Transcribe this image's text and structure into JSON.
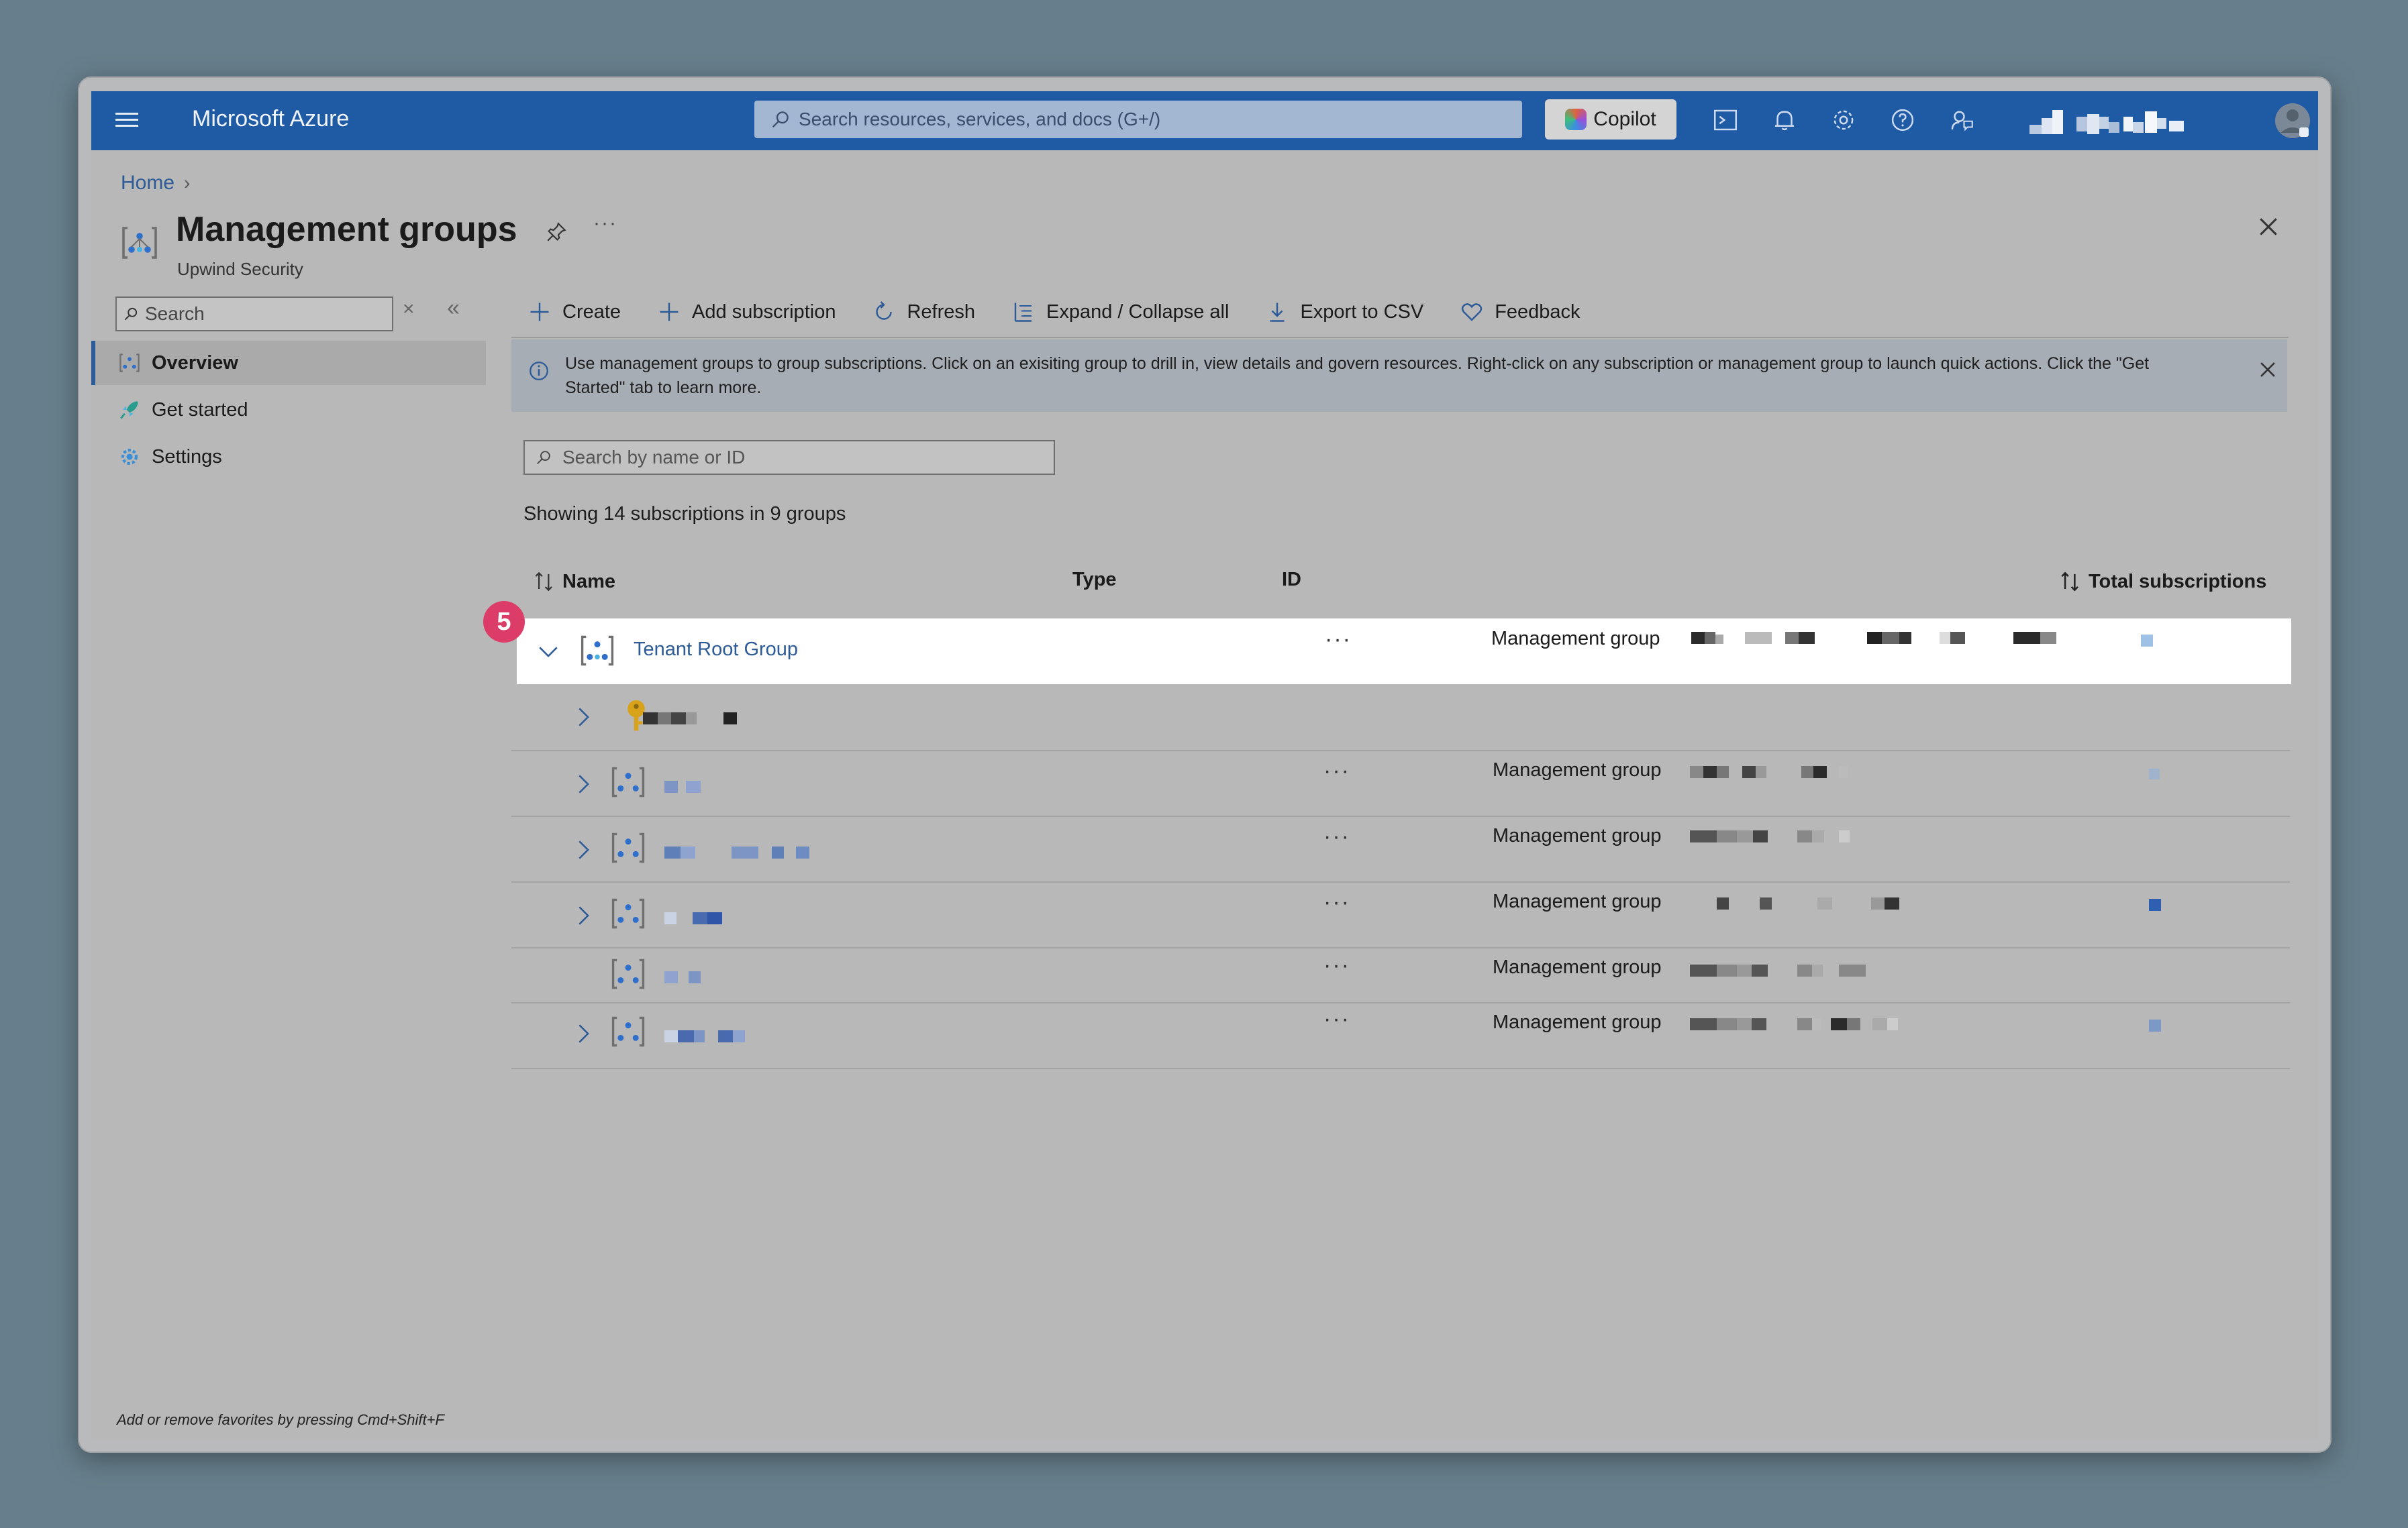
{
  "topbar": {
    "brand": "Microsoft Azure",
    "search_placeholder": "Search resources, services, and docs (G+/)",
    "copilot_label": "Copilot",
    "icons": [
      "cloud-shell-icon",
      "bell-icon",
      "gear-icon",
      "help-icon",
      "feedback-icon",
      "avatar"
    ]
  },
  "breadcrumb": {
    "home": "Home"
  },
  "header": {
    "title": "Management groups",
    "subtitle": "Upwind Security",
    "more": "···"
  },
  "nav": {
    "search_placeholder": "Search",
    "clear": "×",
    "collapse": "«",
    "items": [
      {
        "label": "Overview",
        "icon": "management-group-icon",
        "active": true
      },
      {
        "label": "Get started",
        "icon": "rocket-icon",
        "active": false
      },
      {
        "label": "Settings",
        "icon": "gear-icon",
        "active": false
      }
    ],
    "footer": "Add or remove favorites by pressing Cmd+Shift+F"
  },
  "toolbar": {
    "create": "Create",
    "add_subscription": "Add subscription",
    "refresh": "Refresh",
    "expand_collapse": "Expand / Collapse all",
    "export_csv": "Export to CSV",
    "feedback": "Feedback"
  },
  "info": {
    "message": "Use management groups to group subscriptions. Click on an exisiting group to drill in, view details and govern resources. Right-click on any subscription or management group to launch quick actions. Click the \"Get Started\" tab to learn more."
  },
  "grid": {
    "search_placeholder": "Search by name or ID",
    "summary": "Showing 14 subscriptions in 9 groups",
    "columns": {
      "name": "Name",
      "type": "Type",
      "id": "ID",
      "total": "Total subscriptions"
    },
    "more_label": "···",
    "rows": [
      {
        "name": "Tenant Root Group",
        "type": "Management group",
        "kind": "root",
        "expanded": true
      },
      {
        "name": "",
        "type": "",
        "kind": "subscription"
      },
      {
        "name": "",
        "type": "Management group",
        "kind": "group"
      },
      {
        "name": "",
        "type": "Management group",
        "kind": "group"
      },
      {
        "name": "",
        "type": "Management group",
        "kind": "group"
      },
      {
        "name": "",
        "type": "Management group",
        "kind": "group-leaf"
      },
      {
        "name": "",
        "type": "Management group",
        "kind": "group"
      }
    ]
  },
  "step_badge": "5",
  "colors": {
    "azure_blue": "#1f5aa5",
    "link": "#2c5b98",
    "badge": "#dc3c68"
  }
}
